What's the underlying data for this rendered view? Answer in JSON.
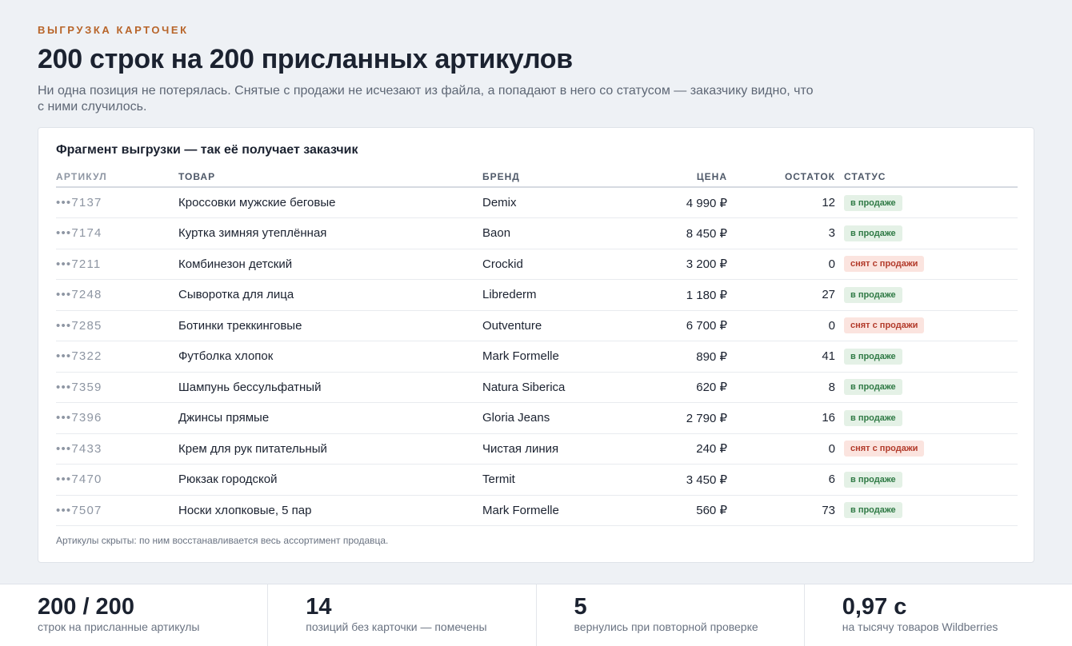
{
  "header": {
    "eyebrow": "ВЫГРУЗКА КАРТОЧЕК",
    "title": "200 строк на 200 присланных артикулов",
    "subtitle": "Ни одна позиция не потерялась. Снятые с продажи не исчезают из файла, а попадают в него со статусом — заказчику видно, что с ними случилось."
  },
  "card": {
    "title": "Фрагмент выгрузки — так её получает заказчик",
    "columns": {
      "sku": "Артикул",
      "name": "Товар",
      "brand": "Бренд",
      "price": "Цена",
      "stock": "Остаток",
      "status": "Статус"
    },
    "rows": [
      {
        "sku": "•••7137",
        "name": "Кроссовки мужские беговые",
        "brand": "Demix",
        "price": "4 990 ₽",
        "stock": "12",
        "status": "в продаже",
        "state": "sale"
      },
      {
        "sku": "•••7174",
        "name": "Куртка зимняя утеплённая",
        "brand": "Baon",
        "price": "8 450 ₽",
        "stock": "3",
        "status": "в продаже",
        "state": "sale"
      },
      {
        "sku": "•••7211",
        "name": "Комбинезон детский",
        "brand": "Crockid",
        "price": "3 200 ₽",
        "stock": "0",
        "status": "снят с продажи",
        "state": "off"
      },
      {
        "sku": "•••7248",
        "name": "Сыворотка для лица",
        "brand": "Librederm",
        "price": "1 180 ₽",
        "stock": "27",
        "status": "в продаже",
        "state": "sale"
      },
      {
        "sku": "•••7285",
        "name": "Ботинки треккинговые",
        "brand": "Outventure",
        "price": "6 700 ₽",
        "stock": "0",
        "status": "снят с продажи",
        "state": "off"
      },
      {
        "sku": "•••7322",
        "name": "Футболка хлопок",
        "brand": "Mark Formelle",
        "price": "890 ₽",
        "stock": "41",
        "status": "в продаже",
        "state": "sale"
      },
      {
        "sku": "•••7359",
        "name": "Шампунь бессульфатный",
        "brand": "Natura Siberica",
        "price": "620 ₽",
        "stock": "8",
        "status": "в продаже",
        "state": "sale"
      },
      {
        "sku": "•••7396",
        "name": "Джинсы прямые",
        "brand": "Gloria Jeans",
        "price": "2 790 ₽",
        "stock": "16",
        "status": "в продаже",
        "state": "sale"
      },
      {
        "sku": "•••7433",
        "name": "Крем для рук питательный",
        "brand": "Чистая линия",
        "price": "240 ₽",
        "stock": "0",
        "status": "снят с продажи",
        "state": "off"
      },
      {
        "sku": "•••7470",
        "name": "Рюкзак городской",
        "brand": "Termit",
        "price": "3 450 ₽",
        "stock": "6",
        "status": "в продаже",
        "state": "sale"
      },
      {
        "sku": "•••7507",
        "name": "Носки хлопковые, 5 пар",
        "brand": "Mark Formelle",
        "price": "560 ₽",
        "stock": "73",
        "status": "в продаже",
        "state": "sale"
      }
    ],
    "footnote": "Артикулы скрыты: по ним восстанавливается весь ассортимент продавца."
  },
  "stats": [
    {
      "value": "200 / 200",
      "label": "строк на присланные артикулы"
    },
    {
      "value": "14",
      "label": "позиций без карточки — помечены"
    },
    {
      "value": "5",
      "label": "вернулись при повторной проверке"
    },
    {
      "value": "0,97 с",
      "label": "на тысячу товаров Wildberries"
    }
  ],
  "colors": {
    "accent": "#b8652a",
    "status_sale_bg": "#e4f1e6",
    "status_sale_text": "#2f7a45",
    "status_off_bg": "#fbe4df",
    "status_off_text": "#b23a2a"
  }
}
